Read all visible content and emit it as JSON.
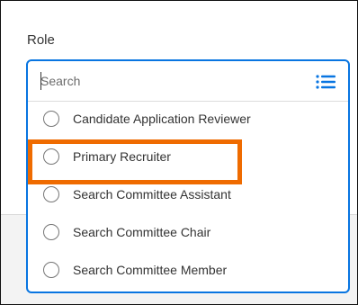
{
  "field": {
    "label": "Role"
  },
  "search": {
    "placeholder": "Search",
    "value": ""
  },
  "options": [
    {
      "label": "Candidate Application Reviewer",
      "selected": false
    },
    {
      "label": "Primary Recruiter",
      "selected": false
    },
    {
      "label": "Search Committee Assistant",
      "selected": false
    },
    {
      "label": "Search Committee Chair",
      "selected": false
    },
    {
      "label": "Search Committee Member",
      "selected": false
    }
  ],
  "colors": {
    "focus_border": "#0875e1",
    "annotation": "#ef6b00",
    "icon": "#0875e1"
  },
  "icons": {
    "list": "list-icon",
    "radio": "radio-unselected-icon"
  }
}
